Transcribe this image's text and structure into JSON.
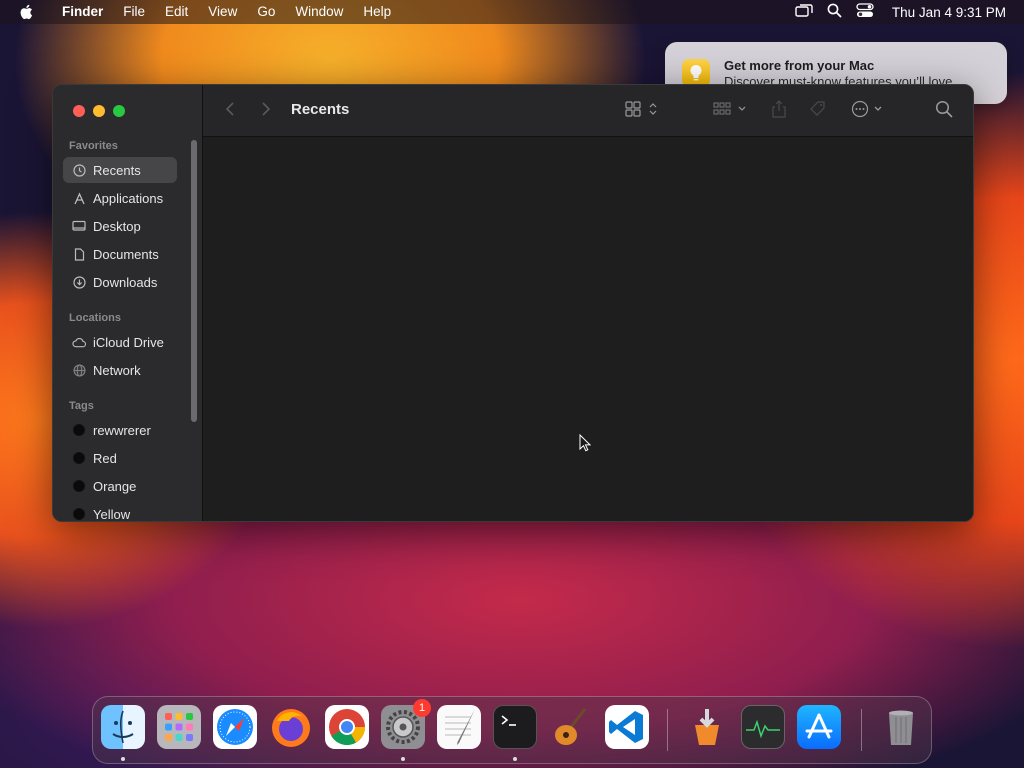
{
  "menubar": {
    "app_name": "Finder",
    "menus": [
      "File",
      "Edit",
      "View",
      "Go",
      "Window",
      "Help"
    ],
    "clock": "Thu Jan 4  9:31 PM"
  },
  "notification": {
    "title": "Get more from your Mac",
    "body": "Discover must-know features you’ll love."
  },
  "finder": {
    "title": "Recents",
    "sidebar": {
      "favorites_header": "Favorites",
      "favorites": [
        "Recents",
        "Applications",
        "Desktop",
        "Documents",
        "Downloads"
      ],
      "locations_header": "Locations",
      "locations": [
        "iCloud Drive",
        "Network"
      ],
      "tags_header": "Tags",
      "tags": [
        "rewwrerer",
        "Red",
        "Orange",
        "Yellow"
      ]
    }
  },
  "dock": {
    "apps": [
      "Finder",
      "Launchpad",
      "Safari",
      "Firefox",
      "Chrome",
      "System Settings",
      "TextEdit",
      "Terminal",
      "GarageBand",
      "Visual Studio Code",
      "Installer",
      "Activity Monitor",
      "App Store",
      "Trash"
    ],
    "settings_badge": "1"
  },
  "colors": {
    "close": "#ff5f57",
    "minimize": "#febc2e",
    "zoom": "#28c840"
  }
}
